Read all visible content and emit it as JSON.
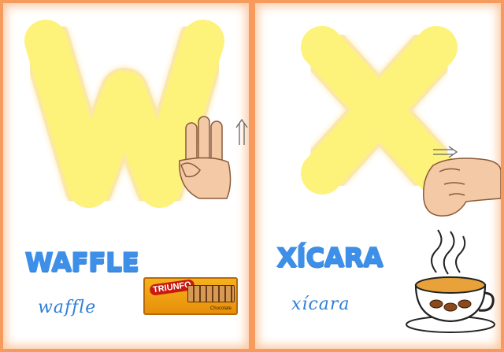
{
  "cards": [
    {
      "letter": "W",
      "word": "WAFFLE",
      "cursive": "waffle",
      "product": {
        "brand": "TRIUNFO",
        "flavor": "Chocolate"
      }
    },
    {
      "letter": "X",
      "word": "XÍCARA",
      "cursive": "xícara"
    }
  ],
  "colors": {
    "letter_fill": "#fdf27a",
    "letter_glow": "#fbe7a8",
    "card_border": "#f79a5e",
    "word_blue": "#3d8fe8",
    "skin": "#f3c9a6"
  }
}
